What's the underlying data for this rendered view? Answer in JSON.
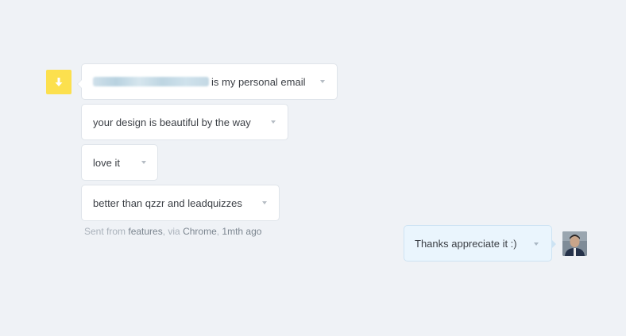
{
  "conversation": {
    "visitor_messages": [
      {
        "text": "is my personal email",
        "has_redacted_email": true
      },
      {
        "text": "your design is beautiful by the way"
      },
      {
        "text": "love it"
      },
      {
        "text": "better than qzzr and leadquizzes"
      }
    ],
    "meta": {
      "prefix": "Sent from ",
      "source": "features",
      "via_prefix": ", via ",
      "browser": "Chrome",
      "time_sep": ", ",
      "age": "1mth ago"
    },
    "agent_reply": {
      "text": "Thanks appreciate it :)"
    }
  },
  "colors": {
    "background": "#eff2f6",
    "visitor_avatar": "#fce04e",
    "reply_bubble": "#eaf5fd"
  },
  "icons": {
    "visitor_avatar": "download-arrow-icon",
    "menu_caret": "chevron-down-icon",
    "agent_avatar": "user-photo"
  }
}
